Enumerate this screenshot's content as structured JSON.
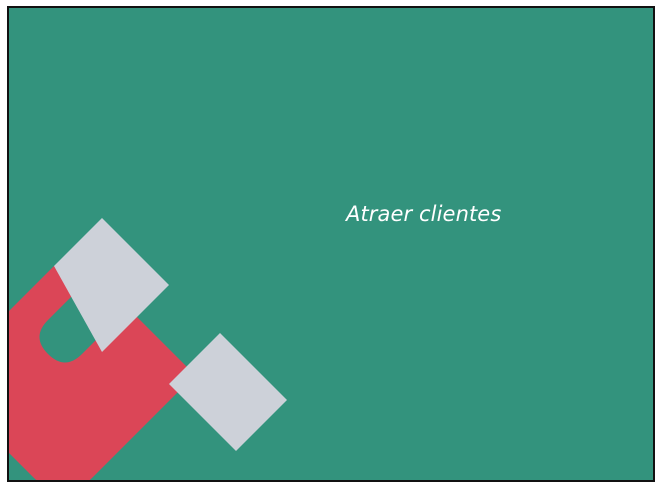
{
  "slide": {
    "caption": "Atraer clientes",
    "background_color": "#33937d",
    "magnet_icon": "magnet-icon",
    "magnet_color": "#db4657",
    "magnet_tip_color": "#cdd1d9"
  }
}
